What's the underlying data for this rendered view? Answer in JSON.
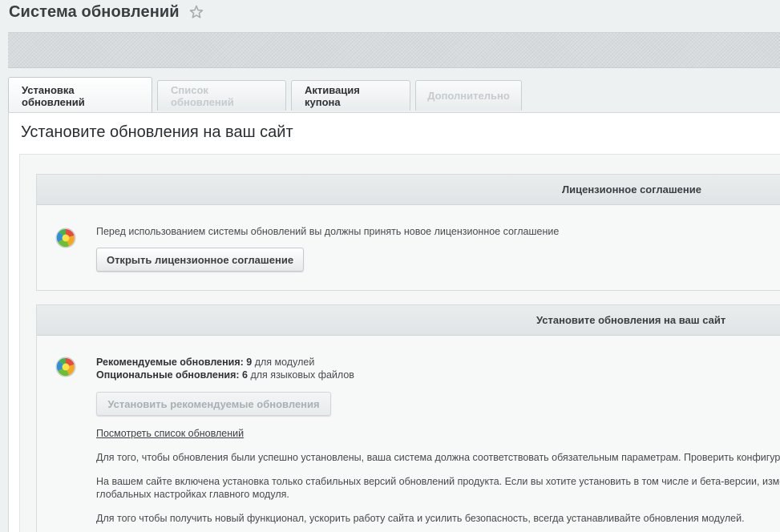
{
  "page": {
    "title": "Система обновлений"
  },
  "tabs": {
    "install": "Установка обновлений",
    "list": "Список обновлений",
    "coupon": "Активация купона",
    "extra": "Дополнительно"
  },
  "content": {
    "title": "Установите обновления на ваш сайт"
  },
  "license": {
    "header": "Лицензионное соглашение",
    "text": "Перед использованием системы обновлений вы должны принять новое лицензионное соглашение",
    "button": "Открыть лицензионное соглашение"
  },
  "updates": {
    "header": "Установите обновления на ваш сайт",
    "recommended_label": "Рекомендуемые обновления:",
    "recommended_count": "9",
    "recommended_suffix": "для модулей",
    "optional_label": "Опциональные обновления:",
    "optional_count": "6",
    "optional_suffix": "для языковых файлов",
    "install_button": "Установить рекомендуемые обновления",
    "view_link": "Посмотреть список обновлений",
    "para1": "Для того, чтобы обновления были успешно установлены, ваша система должна соответствовать обязательным параметрам. Проверить конфигурацию",
    "para2_line1": "На вашем сайте включена установка только стабильных версий обновлений продукта. Если вы хотите установить в том числе и бета-версии, измените",
    "para2_line2": "глобальных настройках главного модуля.",
    "para3": "Для того чтобы получить новый функционал, ускорить работу сайта и усилить безопасность, всегда устанавливайте обновления модулей."
  },
  "icons": {
    "star": "star-icon",
    "status": "update-status-icon"
  }
}
